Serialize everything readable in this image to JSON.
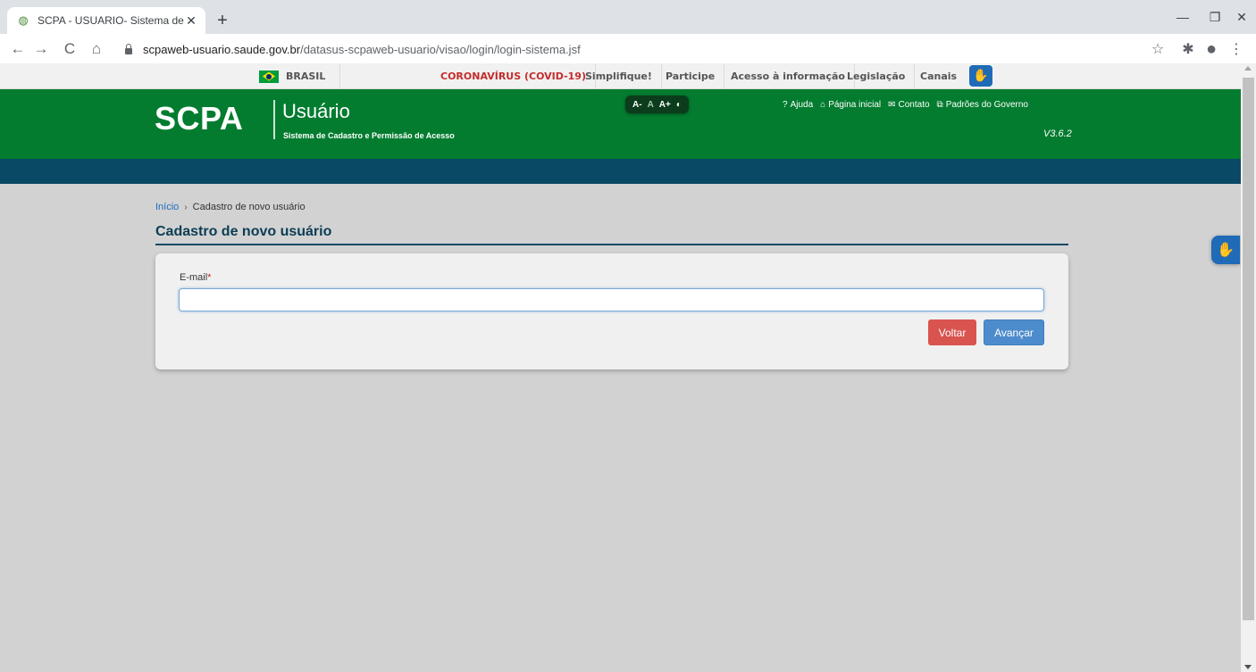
{
  "browser": {
    "tab_title": "SCPA - USUARIO- Sistema de Ca",
    "tab_close": "✕",
    "new_tab": "+",
    "url_host": "scpaweb-usuario.saude.gov.br",
    "url_path": "/datasus-scpaweb-usuario/visao/login/login-sistema.jsf",
    "back": "←",
    "forward": "→",
    "reload": "C",
    "home": "⌂",
    "star": "☆",
    "extensions": "✱",
    "profile": "●",
    "menu": "⋮",
    "minimize": "—",
    "restore": "❐",
    "close": "✕"
  },
  "govbar": {
    "brasil": "BRASIL",
    "covid": "CORONAVÍRUS (COVID-19)",
    "simplifique": "Simplifique!",
    "participe": "Participe",
    "acesso": "Acesso à informação",
    "legislacao": "Legislação",
    "canais": "Canais",
    "vlibras": "✋"
  },
  "header": {
    "logo": "SCPA",
    "app_name": "Usuário",
    "subtitle": "Sistema de Cadastro e Permissão de Acesso",
    "font_decrease": "A-",
    "font_normal": "A",
    "font_increase": "A+",
    "contrast": "◐",
    "links": {
      "ajuda_icon": "?",
      "ajuda": "Ajuda",
      "inicial_icon": "⌂",
      "inicial": "Página inicial",
      "contato_icon": "✉",
      "contato": "Contato",
      "padroes_icon": "⧉",
      "padroes": "Padrões do Governo"
    },
    "version": "V3.6.2"
  },
  "breadcrumb": {
    "home": "Início",
    "separator": "›",
    "current": "Cadastro de novo usuário"
  },
  "page": {
    "title": "Cadastro de novo usuário",
    "email_label": "E-mail",
    "required_mark": "*",
    "email_value": "",
    "email_placeholder": "",
    "voltar": "Voltar",
    "avancar": "Avançar"
  },
  "side": {
    "vlibras": "✋"
  },
  "colors": {
    "header_green": "#037c2f",
    "subbar_blue": "#0a4965",
    "danger": "#d9534f",
    "primary": "#4d8ccc"
  }
}
